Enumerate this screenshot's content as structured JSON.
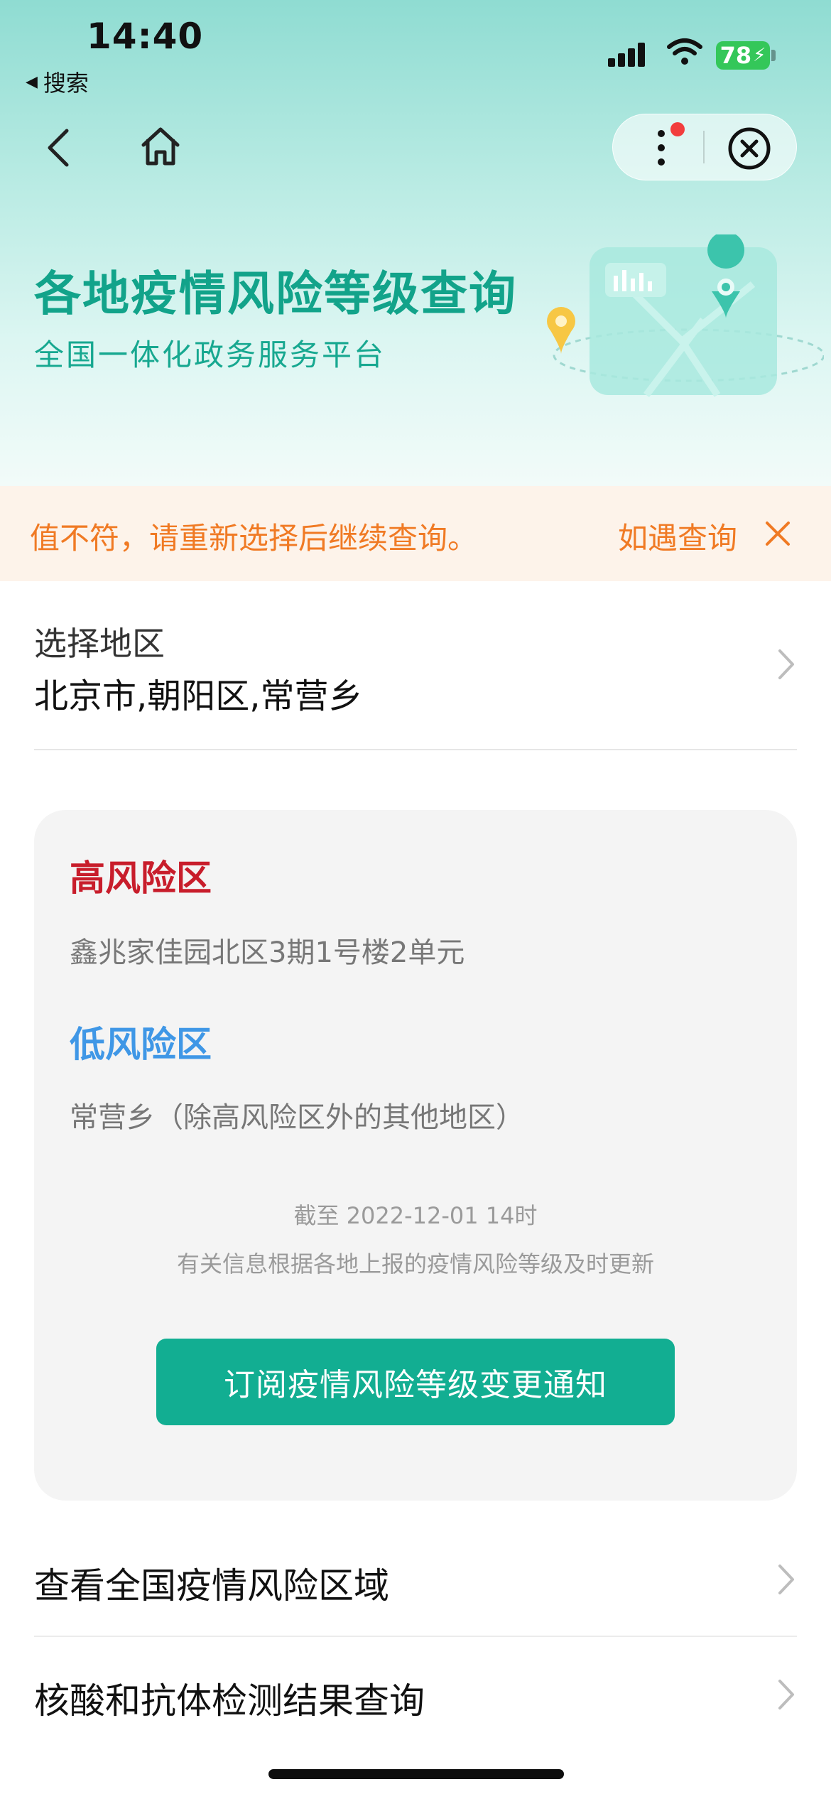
{
  "status_bar": {
    "time": "14:40",
    "back_app": "搜索",
    "battery": "78"
  },
  "header": {
    "title": "各地疫情风险等级查询",
    "subtitle": "全国一体化政务服务平台"
  },
  "notice": {
    "text": "值不符，请重新选择后继续查询。",
    "text_next": "如遇查询"
  },
  "region": {
    "label": "选择地区",
    "value": "北京市,朝阳区,常营乡"
  },
  "risk": {
    "high_title": "高风险区",
    "high_area": "鑫兆家佳园北区3期1号楼2单元",
    "low_title": "低风险区",
    "low_area": "常营乡（除高风险区外的其他地区）",
    "as_of": "截至 2022-12-01 14时",
    "note": "有关信息根据各地上报的疫情风险等级及时更新",
    "subscribe_label": "订阅疫情风险等级变更通知"
  },
  "links": [
    {
      "label": "查看全国疫情风险区域"
    },
    {
      "label": "核酸和抗体检测结果查询"
    }
  ],
  "colors": {
    "accent": "#12ae92",
    "high": "#c81d2b",
    "low": "#3f97e6",
    "notice": "#f07a24"
  }
}
